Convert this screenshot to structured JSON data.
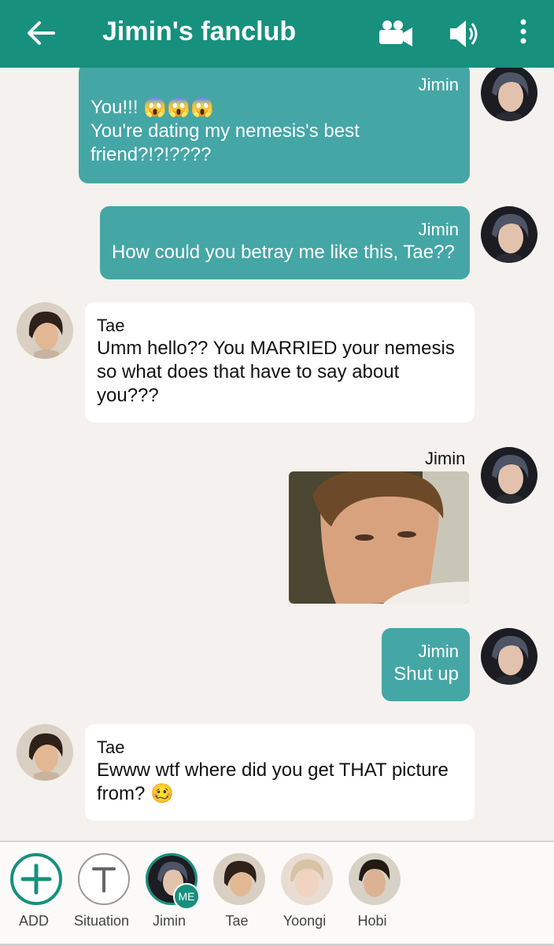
{
  "header": {
    "title": "Jimin's fanclub"
  },
  "colors": {
    "primary": "#17907d",
    "me_bubble": "#45a6a6",
    "background": "#f4f1ee"
  },
  "messages": [
    {
      "sender": "Jimin",
      "line1": "You!!! 😱😱😱",
      "line2": "You're dating my nemesis's best",
      "line3": "friend?!?!????"
    },
    {
      "sender": "Jimin",
      "line1": "How could you betray me like this, Tae??"
    },
    {
      "sender": "Tae",
      "line1": "Umm hello?? You MARRIED your nemesis",
      "line2": "so what does that have to say about",
      "line3": "you???"
    },
    {
      "sender": "Jimin",
      "image": "photo-of-tae-side-eye"
    },
    {
      "sender": "Jimin",
      "line1": "Shut up"
    },
    {
      "sender": "Tae",
      "line1": "Ewww wtf where did you get THAT picture",
      "line2": "from? 🥴"
    }
  ],
  "cast_bar": {
    "items": [
      {
        "label": "ADD",
        "icon": "plus-icon"
      },
      {
        "label": "Situation",
        "icon": "t-icon"
      },
      {
        "label": "Jimin",
        "badge": "ME"
      },
      {
        "label": "Tae"
      },
      {
        "label": "Yoongi"
      },
      {
        "label": "Hobi"
      }
    ]
  }
}
